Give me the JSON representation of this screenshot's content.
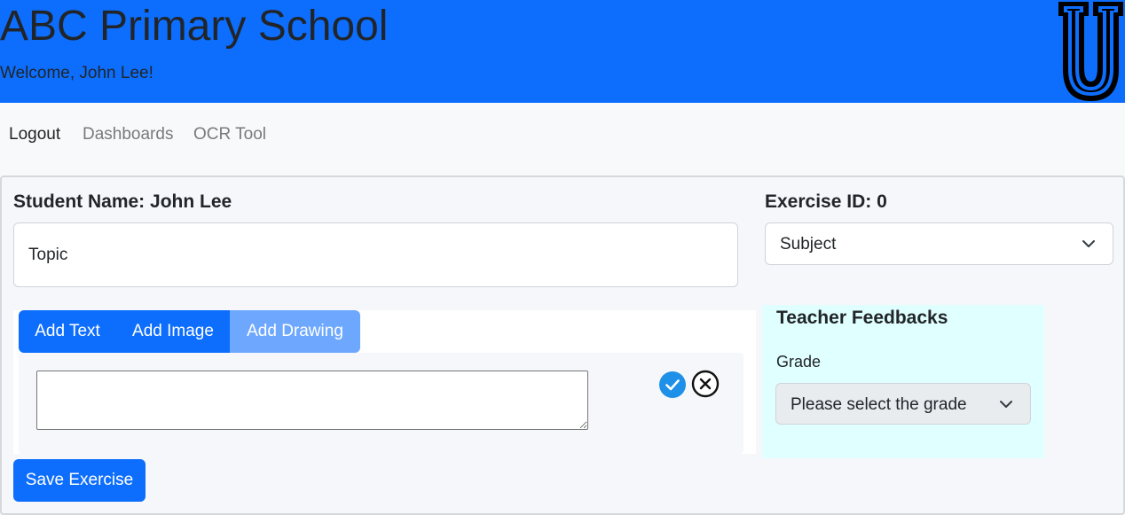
{
  "header": {
    "school_name": "ABC Primary School",
    "welcome": "Welcome, John Lee!",
    "logo_icon": "university-u-logo",
    "bg_color": "#0d6efd"
  },
  "nav": {
    "items": [
      {
        "label": "Logout"
      },
      {
        "label": "Dashboards"
      },
      {
        "label": "OCR Tool"
      }
    ]
  },
  "exercise": {
    "student_name": "Student Name: John Lee",
    "exercise_id": "Exercise ID: 0",
    "topic_placeholder": "Topic",
    "topic_value": "",
    "subject_selected": "Subject"
  },
  "toolbar": {
    "add_text": "Add Text",
    "add_image": "Add Image",
    "add_drawing": "Add Drawing"
  },
  "editor": {
    "text_value": "",
    "confirm_icon": "check-circle-icon",
    "cancel_icon": "x-circle-icon"
  },
  "feedback": {
    "title": "Teacher Feedbacks",
    "grade_label": "Grade",
    "grade_selected": "Please select the grade"
  },
  "actions": {
    "save_label": "Save Exercise"
  },
  "colors": {
    "primary": "#0d6efd",
    "primary_light": "#6ea8fe",
    "feedback_bg": "#e0ffff"
  }
}
